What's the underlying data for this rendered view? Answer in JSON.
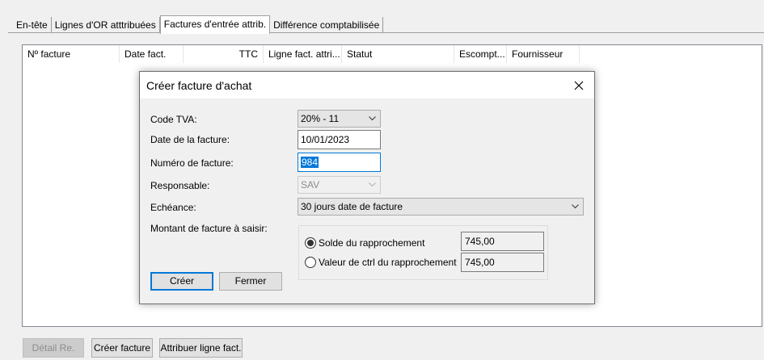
{
  "tabs": [
    {
      "label": "En-tête"
    },
    {
      "label": "Lignes d'OR atttribuées"
    },
    {
      "label": "Factures d'entrée attrib."
    },
    {
      "label": "Différence comptabilisée"
    }
  ],
  "list": {
    "columns": [
      "Nº facture",
      "Date fact.",
      "TTC",
      "Ligne fact. attri...",
      "Statut",
      "Escompt...",
      "Fournisseur"
    ]
  },
  "bottom_buttons": {
    "detail_label": "Détail Re.",
    "create_invoice_label": "Créer facture",
    "assign_line_label": "Attribuer ligne fact."
  },
  "dialog": {
    "title": "Créer facture d'achat",
    "vat_code_label": "Code TVA:",
    "vat_code_value": "20% - 11",
    "invoice_date_label": "Date de la facture:",
    "invoice_date_value": "10/01/2023",
    "invoice_number_label": "Numéro de facture:",
    "invoice_number_value": "984",
    "responsible_label": "Responsable:",
    "responsible_value": "SAV",
    "due_label": "Echéance:",
    "due_value": "30 jours date de facture",
    "amount_label": "Montant de facture à saisir:",
    "option_balance_label": "Solde du rapprochement",
    "option_balance_value": "745,00",
    "option_balance_selected": true,
    "option_control_label": "Valeur de ctrl du rapprochement",
    "option_control_value": "745,00",
    "create_label": "Créer",
    "close_label": "Fermer"
  },
  "colors": {
    "accent": "#0078d7",
    "window_bg": "#f0f0f0",
    "list_bg": "#ffffff"
  },
  "icons": [
    "close-icon",
    "chevron-down-icon"
  ]
}
